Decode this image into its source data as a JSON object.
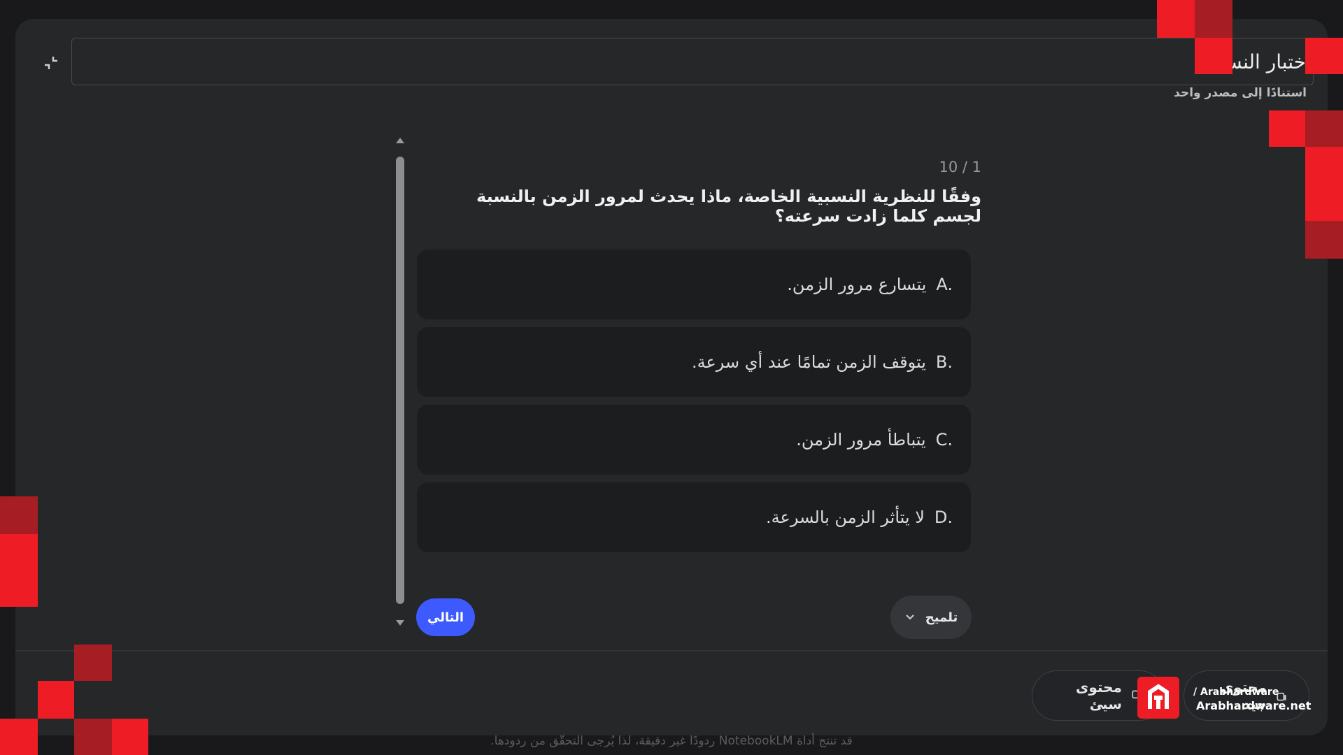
{
  "header": {
    "title": "ختبار النسب",
    "subtitle": "استنادًا إلى مصدر واحد"
  },
  "quiz": {
    "counter": "10 / 1",
    "question": "وفقًا للنظرية النسبية الخاصة، ماذا يحدث لمرور الزمن بالنسبة لجسم كلما زادت سرعته؟",
    "options": [
      {
        "letter": "A.",
        "text": "يتسارع مرور الزمن."
      },
      {
        "letter": "B.",
        "text": "يتوقف الزمن تمامًا عند أي سرعة."
      },
      {
        "letter": "C.",
        "text": "يتباطأ مرور الزمن."
      },
      {
        "letter": "D.",
        "text": "لا يتأثر الزمن بالسرعة."
      }
    ],
    "next_label": "التالي",
    "hint_label": "تلميح"
  },
  "footer": {
    "chip_1_label": "محتوى سيئ",
    "chip_2_label": "محتوى جيد",
    "disclaimer": "قد تنتج أداة NotebookLM ردودًا غير دقيقة، لذا يُرجى التحقّق من ردودها."
  },
  "watermark": {
    "line1": "/ Arabhardware",
    "line2": "Arabhardware.net"
  },
  "colors": {
    "accent": "#3d5afe",
    "brand_red": "#ee1c25"
  }
}
